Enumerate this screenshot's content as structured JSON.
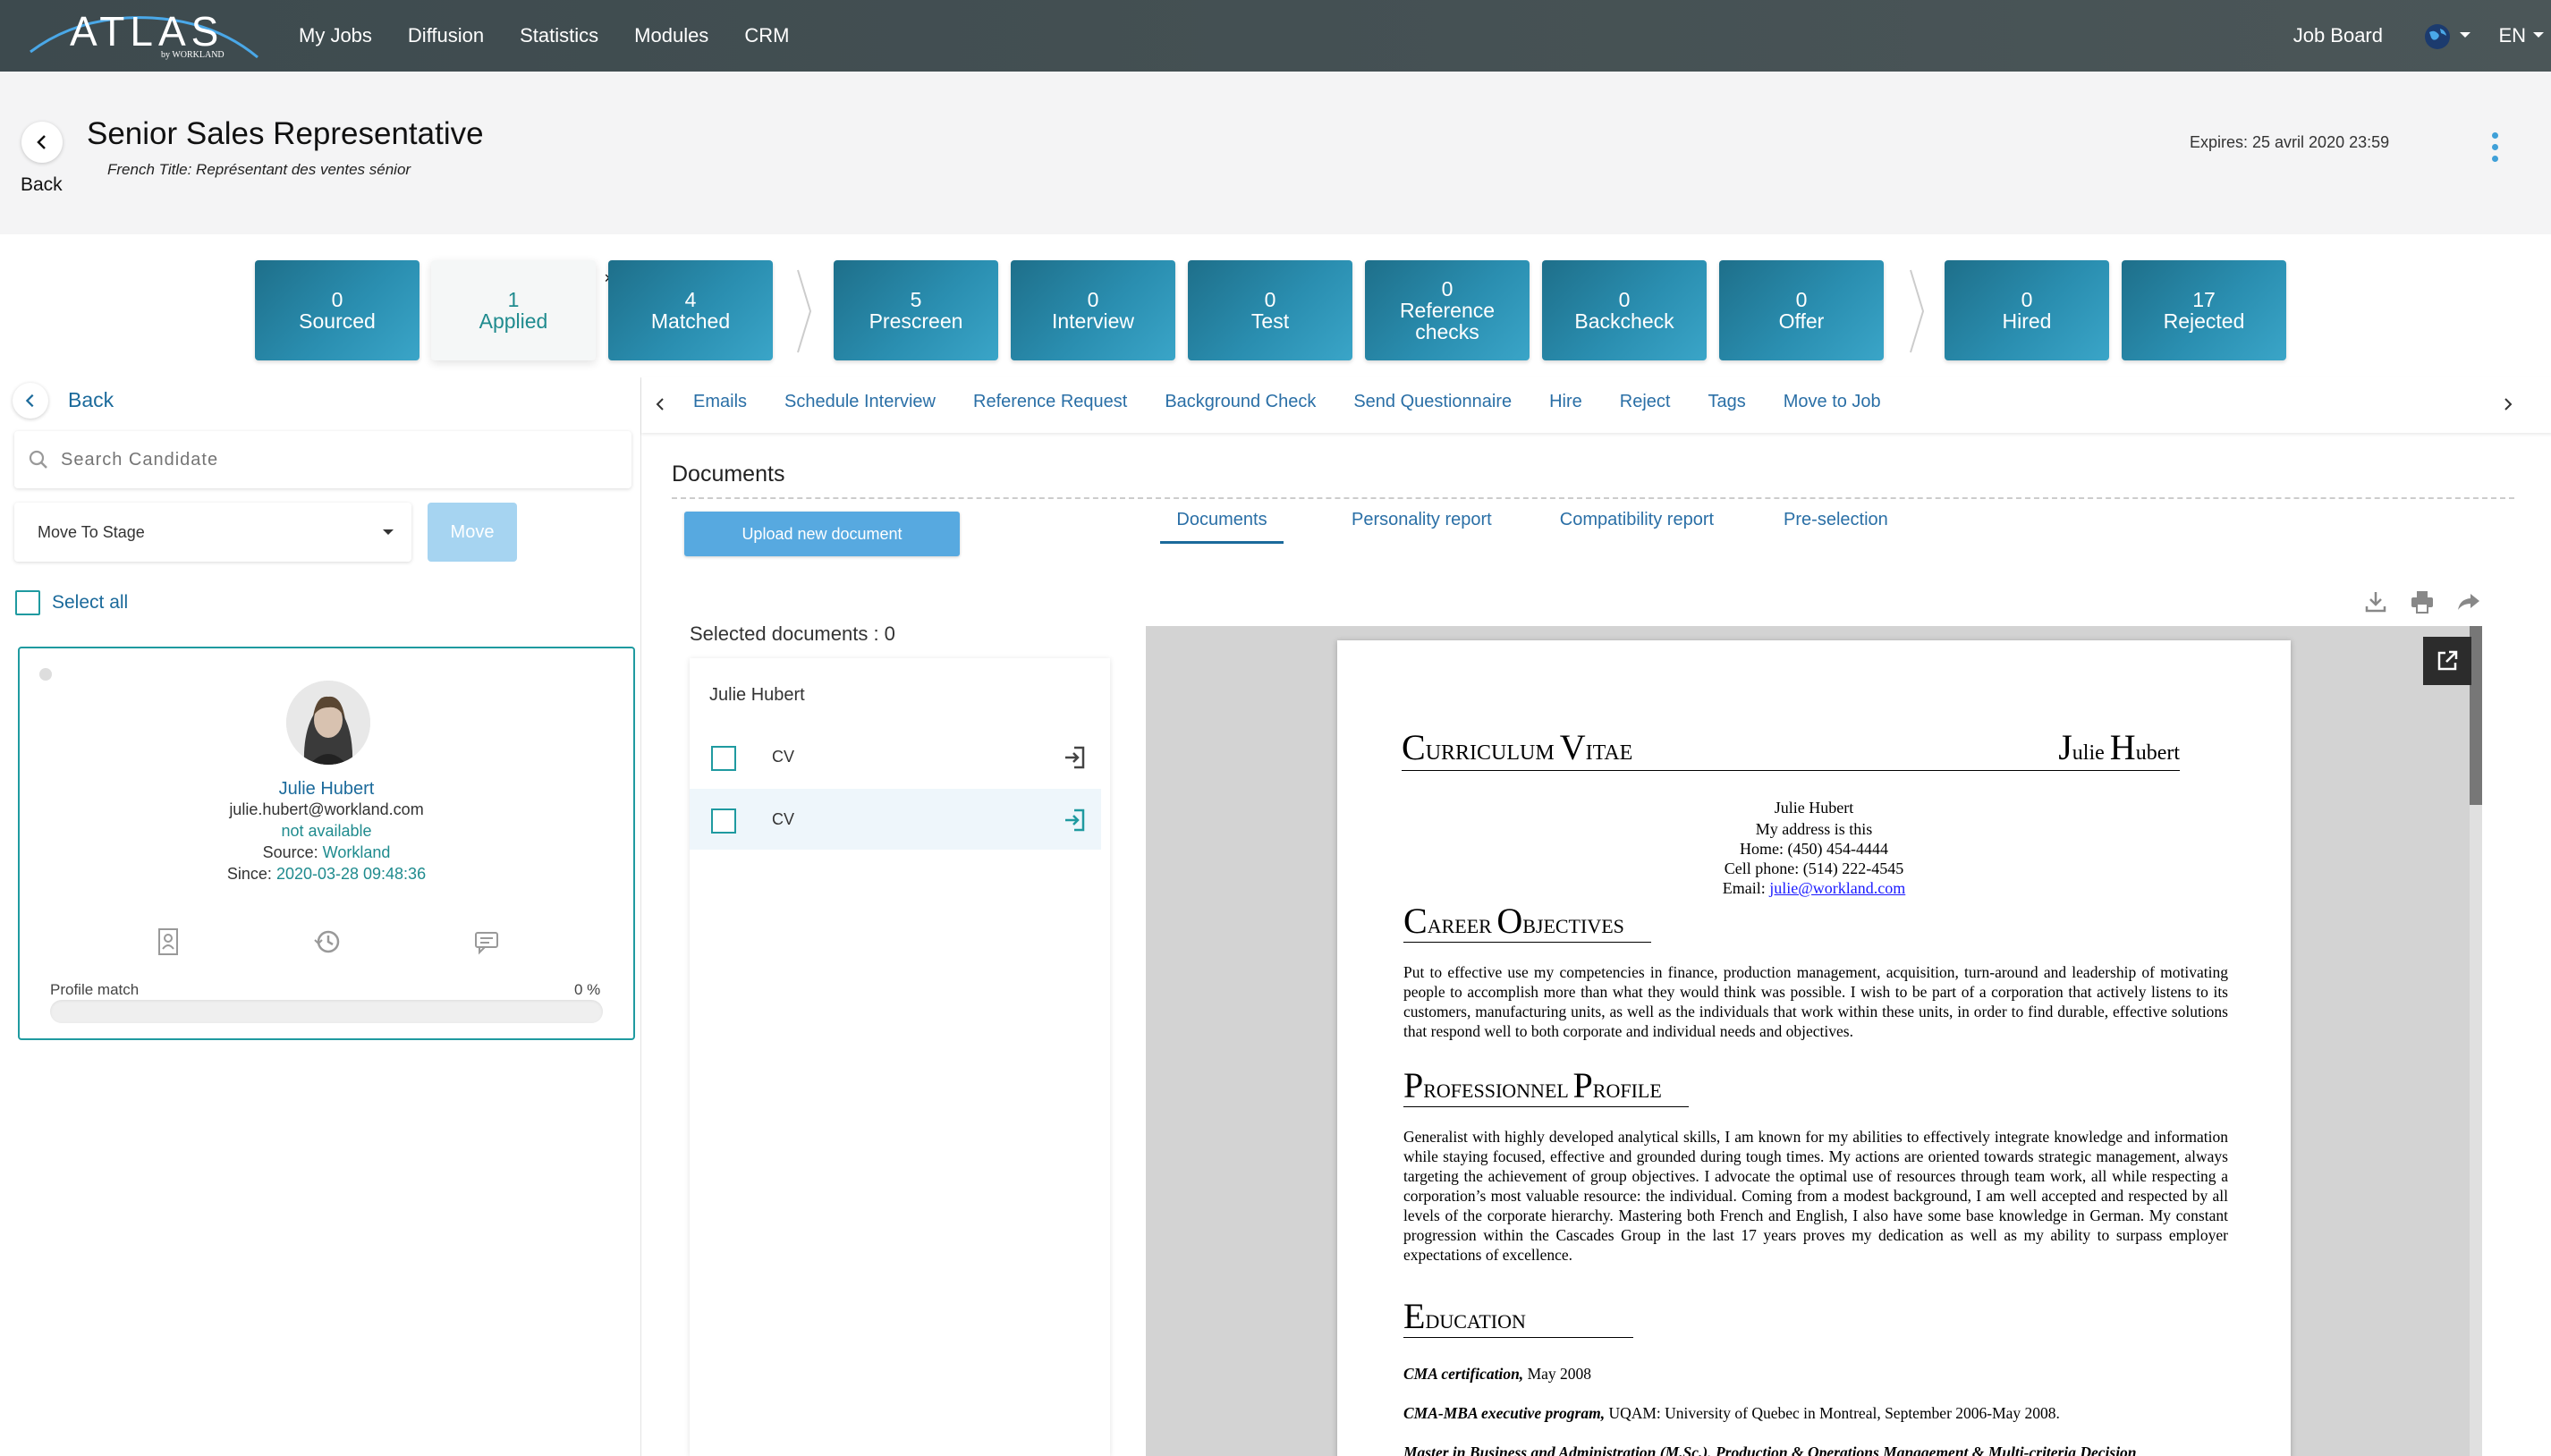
{
  "app": {
    "logo": "ATLAS",
    "logo_sub": "by WORKLAND",
    "nav": [
      "My Jobs",
      "Diffusion",
      "Statistics",
      "Modules",
      "CRM"
    ],
    "job_board": "Job Board",
    "lang": "EN"
  },
  "header": {
    "back": "Back",
    "title": "Senior Sales Representative",
    "french_title": "French Title: Représentant des ventes sénior",
    "expires": "Expires: 25 avril 2020 23:59"
  },
  "stages": [
    {
      "count": "0",
      "label": "Sourced"
    },
    {
      "count": "1",
      "label": "Applied"
    },
    {
      "count": "4",
      "label": "Matched"
    },
    {
      "count": "5",
      "label": "Prescreen"
    },
    {
      "count": "0",
      "label": "Interview"
    },
    {
      "count": "0",
      "label": "Test"
    },
    {
      "count": "0",
      "label": "Reference checks"
    },
    {
      "count": "0",
      "label": "Backcheck"
    },
    {
      "count": "0",
      "label": "Offer"
    },
    {
      "count": "0",
      "label": "Hired"
    },
    {
      "count": "17",
      "label": "Rejected"
    }
  ],
  "left": {
    "back": "Back",
    "search_placeholder": "Search Candidate",
    "move_to_stage": "Move To Stage",
    "move_button": "Move",
    "select_all": "Select all",
    "candidate": {
      "name": "Julie Hubert",
      "email": "julie.hubert@workland.com",
      "availability": "not available",
      "source_label": "Source:",
      "source": "Workland",
      "since_label": "Since:",
      "since": "2020-03-28 09:48:36",
      "profile_match_label": "Profile match",
      "profile_match": "0 %",
      "profile_match_value": 0
    }
  },
  "actions": [
    "Emails",
    "Schedule Interview",
    "Reference Request",
    "Background Check",
    "Send Questionnaire",
    "Hire",
    "Reject",
    "Tags",
    "Move to Job"
  ],
  "documents": {
    "heading": "Documents",
    "upload": "Upload new document",
    "tabs": [
      "Documents",
      "Personality report",
      "Compatibility report",
      "Pre-selection"
    ],
    "selected": "Selected documents : 0",
    "owner": "Julie Hubert",
    "files": [
      "CV",
      "CV"
    ]
  },
  "cv": {
    "title_c": "C",
    "title_rest1": "URRICULUM ",
    "title_v": "V",
    "title_rest2": "ITAE",
    "owner_j": "J",
    "owner_rest1": "ulie ",
    "owner_h": "H",
    "owner_rest2": "ubert",
    "name": "Julie Hubert",
    "address": "My address is this",
    "home": "Home: (450) 454-4444",
    "cell": "Cell phone: (514) 222-4545",
    "email_label": "Email:",
    "email": "julie@workland.com",
    "sec1_a": "C",
    "sec1_b": "AREER ",
    "sec1_c": "O",
    "sec1_d": "BJECTIVES",
    "objectives": "Put to effective use my competencies in finance, production management, acquisition, turn-around and leadership of motivating people to accomplish more than what they would think was possible. I wish to be part of a corporation that actively listens to its customers, manufacturing units, as well as the individuals that work within these units, in order to find durable, effective solutions that respond well to both corporate and individual needs and objectives.",
    "sec2_a": "P",
    "sec2_b": "ROFESSIONNEL ",
    "sec2_c": "P",
    "sec2_d": "ROFILE",
    "profile": "Generalist with highly developed analytical skills, I am known for my abilities to effectively integrate knowledge and information while staying focused, effective and grounded during tough times.  My actions are oriented towards strategic management, always targeting the achievement of group objectives.  I advocate the optimal use of resources through team work, all while respecting a corporation’s most valuable resource:  the individual.  Coming from a modest background, I am well accepted and respected by all levels of the corporate hierarchy.  Mastering both French and English, I also have some base knowledge in German.  My constant progression within the Cascades Group in the last 17 years proves my dedication as well as my ability to surpass employer expectations of excellence.",
    "sec3_a": "E",
    "sec3_b": "DUCATION",
    "edu1_title": "CMA certification,",
    "edu1_rest": " May 2008",
    "edu2_title": "CMA-MBA executive program,",
    "edu2_rest": " UQAM: University of Quebec in Montreal, September 2006-May 2008.",
    "edu3_title": "Master in Business and Administration (M.Sc.), Production & Operations Management & Multi-criteria Decision"
  }
}
